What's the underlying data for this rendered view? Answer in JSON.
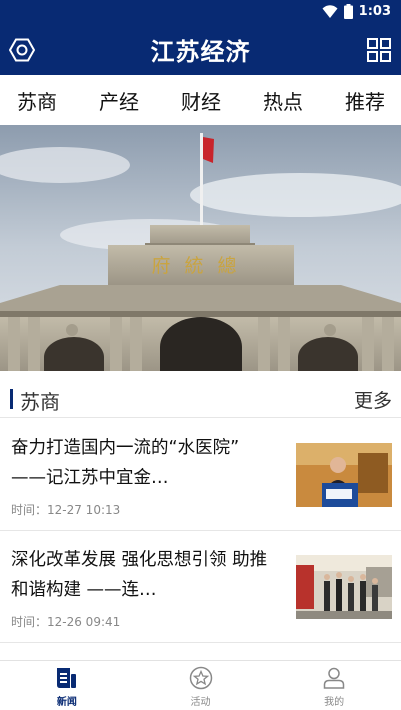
{
  "status": {
    "time": "1:03"
  },
  "header": {
    "title": "江苏经济"
  },
  "tabs": [
    {
      "label": "苏商"
    },
    {
      "label": "产经"
    },
    {
      "label": "财经"
    },
    {
      "label": "热点"
    },
    {
      "label": "推荐"
    }
  ],
  "banner": {
    "plaque_text": "府統總"
  },
  "section": {
    "title": "苏商",
    "more": "更多"
  },
  "news": [
    {
      "title": "奋力打造国内一流的“水医院” ——记江苏中宜金…",
      "time": "时间：12-27 10:13"
    },
    {
      "title": "深化改革发展 强化思想引领 助推和谐构建 ——连…",
      "time": "时间：12-26 09:41"
    }
  ],
  "bottom_nav": [
    {
      "label": "新闻",
      "icon": "news-icon",
      "active": true
    },
    {
      "label": "活动",
      "icon": "star-circle-icon",
      "active": false
    },
    {
      "label": "我的",
      "icon": "user-icon",
      "active": false
    }
  ],
  "colors": {
    "brand": "#082a73",
    "text": "#111111",
    "muted": "#888888"
  }
}
